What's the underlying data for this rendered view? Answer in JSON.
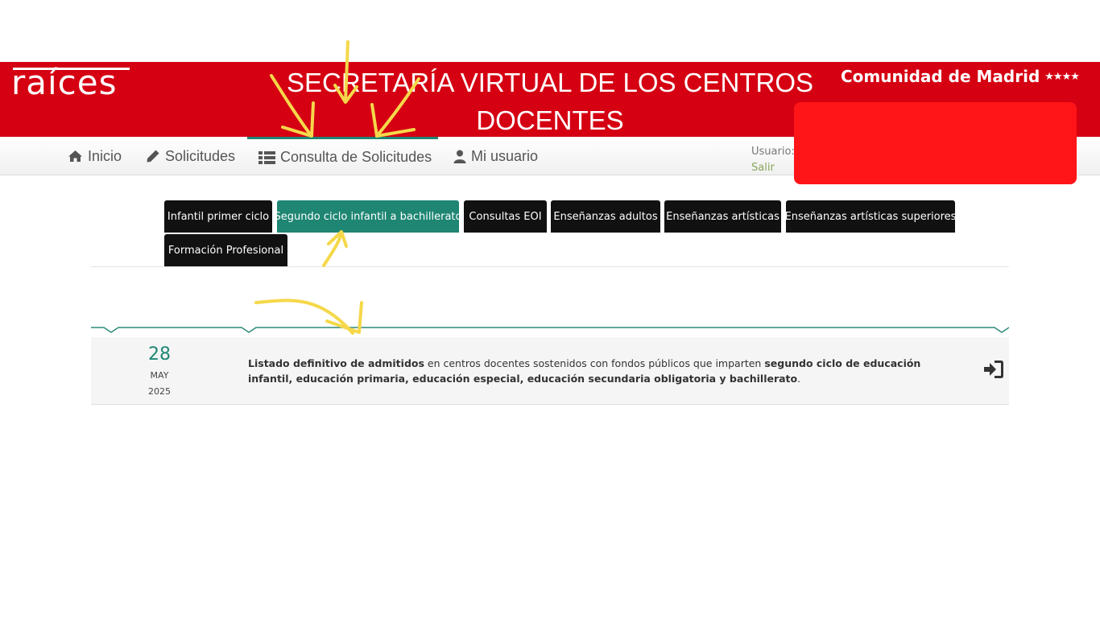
{
  "header": {
    "logo_text": "raíces",
    "title": "SECRETARÍA VIRTUAL DE LOS CENTROS DOCENTES",
    "region": "Comunidad de Madrid",
    "region_stars": "★★★★"
  },
  "nav": {
    "items": [
      {
        "label": "Inicio",
        "icon": "home-icon"
      },
      {
        "label": "Solicitudes",
        "icon": "pencil-icon"
      },
      {
        "label": "Consulta de Solicitudes",
        "icon": "list-icon",
        "active": true
      },
      {
        "label": "Mi usuario",
        "icon": "user-icon"
      }
    ],
    "user_label": "Usuario:",
    "logout_label": "Salir"
  },
  "tabs": [
    {
      "label": "Infantil primer ciclo"
    },
    {
      "label": "Segundo ciclo infantil a bachillerato",
      "active": true
    },
    {
      "label": "Consultas EOI"
    },
    {
      "label": "Enseñanzas adultos"
    },
    {
      "label": "Enseñanzas artísticas"
    },
    {
      "label": "Enseñanzas artísticas superiores"
    },
    {
      "label": "Formación Profesional"
    }
  ],
  "news": [
    {
      "day": "28",
      "month": "MAY",
      "year": "2025",
      "text_parts": [
        {
          "bold": true,
          "text": "Listado definitivo de admitidos"
        },
        {
          "bold": false,
          "text": " en centros docentes sostenidos con fondos públicos que imparten "
        },
        {
          "bold": true,
          "text": "segundo ciclo de educación infantil, educación primaria, educación especial, educación secundaria obligatoria y bachillerato"
        },
        {
          "bold": false,
          "text": "."
        }
      ],
      "action_icon": "sign-in-icon"
    }
  ],
  "colors": {
    "header_red": "#d50012",
    "accent_teal": "#1e8673",
    "tab_dark": "#111111",
    "annotation_yellow": "#f5d84a",
    "redaction_red": "#ff1418"
  }
}
